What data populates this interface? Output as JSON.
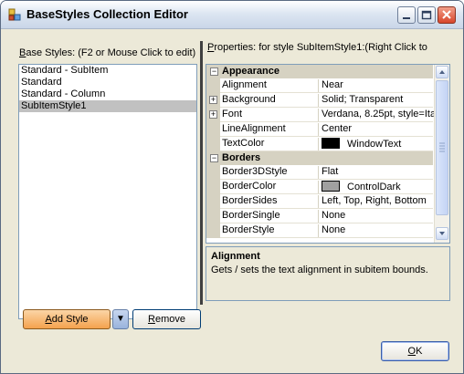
{
  "window": {
    "title": "BaseStyles Collection Editor",
    "minimize_glyph": "–",
    "maximize_glyph": "□",
    "close_glyph": "✕"
  },
  "left": {
    "label_mnemonic": "B",
    "label_rest": "ase Styles: (F2 or Mouse Click to edit)",
    "items": [
      "Standard - SubItem",
      "Standard",
      "Standard - Column",
      "SubItemStyle1"
    ],
    "selected_index": 3
  },
  "right": {
    "label_mnemonic": "P",
    "label_rest": "roperties: for style SubItemStyle1:(Right Click to"
  },
  "grid": {
    "categories": [
      {
        "name": "Appearance",
        "toggle": "−",
        "rows": [
          {
            "name": "Alignment",
            "value": "Near"
          },
          {
            "name": "Background",
            "value": "Solid; Transparent",
            "expand": "+"
          },
          {
            "name": "Font",
            "value": "Verdana, 8.25pt, style=Ita",
            "expand": "+"
          },
          {
            "name": "LineAlignment",
            "value": "Center"
          },
          {
            "name": "TextColor",
            "value": "WindowText",
            "swatch": "#000000"
          }
        ]
      },
      {
        "name": "Borders",
        "toggle": "−",
        "rows": [
          {
            "name": "Border3DStyle",
            "value": "Flat"
          },
          {
            "name": "BorderColor",
            "value": "ControlDark",
            "swatch": "#a0a0a0"
          },
          {
            "name": "BorderSides",
            "value": "Left, Top, Right, Bottom"
          },
          {
            "name": "BorderSingle",
            "value": "None"
          },
          {
            "name": "BorderStyle",
            "value": "None"
          }
        ]
      }
    ]
  },
  "description": {
    "title": "Alignment",
    "text": "Gets / sets the text alignment in subitem bounds."
  },
  "buttons": {
    "add_mnemonic": "A",
    "add_rest": "dd Style",
    "add_dropdown_glyph": "▼",
    "remove_mnemonic": "R",
    "remove_rest": "emove",
    "ok_mnemonic": "O",
    "ok_rest": "K"
  },
  "colors": {
    "selection": "#c1c1c1",
    "category_band": "#d6d2c2",
    "dialog_bg": "#ece9d8"
  }
}
